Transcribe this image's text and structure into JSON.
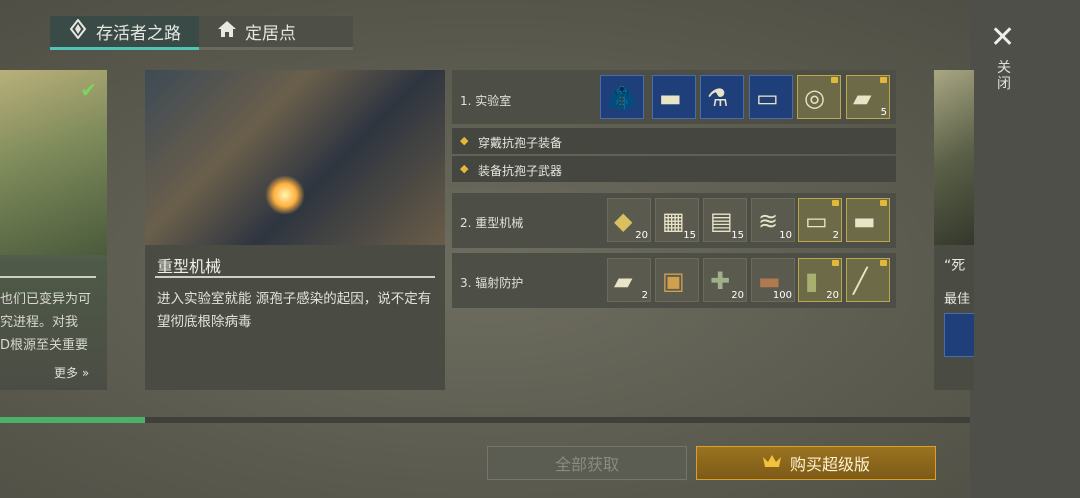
{
  "tabs": [
    {
      "label": "存活者之路",
      "icon": "survivor-emblem-icon"
    },
    {
      "label": "定居点",
      "icon": "home-icon"
    }
  ],
  "left_card": {
    "lines": [
      "也们已变异为可",
      "究进程。对我",
      "D根源至关重要"
    ],
    "more_label": "更多"
  },
  "main_card": {
    "title": "重型机械",
    "description": "进入实验室就能 源孢子感染的起因，说不定有望彻底根除病毒"
  },
  "right_card": {
    "title": "“死",
    "subtitle": "最佳"
  },
  "sections": [
    {
      "label": "1. 实验室",
      "items": [
        {
          "icon": "jacket-icon",
          "count": "",
          "style": "blue",
          "locked": false
        },
        {
          "icon": "pistol-icon",
          "count": "",
          "style": "blue",
          "locked": false
        },
        {
          "icon": "lab-bench-icon",
          "count": "",
          "style": "blue",
          "locked": false
        },
        {
          "icon": "battery-icon",
          "count": "",
          "style": "blue",
          "locked": false
        },
        {
          "icon": "filter-icon",
          "count": "",
          "style": "gold",
          "locked": true
        },
        {
          "icon": "ingot-icon",
          "count": "5",
          "style": "gold",
          "locked": true
        }
      ],
      "sub_items": [
        "穿戴抗孢子装备",
        "装备抗孢子武器"
      ]
    },
    {
      "label": "2. 重型机械",
      "items": [
        {
          "icon": "cloth-icon",
          "count": "20",
          "style": "plain",
          "locked": false
        },
        {
          "icon": "fabric-icon",
          "count": "15",
          "style": "plain",
          "locked": false
        },
        {
          "icon": "scrap-icon",
          "count": "15",
          "style": "plain",
          "locked": false
        },
        {
          "icon": "spring-icon",
          "count": "10",
          "style": "plain",
          "locked": false
        },
        {
          "icon": "battery-icon",
          "count": "2",
          "style": "gold",
          "locked": true
        },
        {
          "icon": "pistol-icon",
          "count": "",
          "style": "gold",
          "locked": true
        }
      ]
    },
    {
      "label": "3. 辐射防护",
      "items": [
        {
          "icon": "ingot-icon",
          "count": "2",
          "style": "plain",
          "locked": false
        },
        {
          "icon": "ammo-box-icon",
          "count": "",
          "style": "plain",
          "locked": false
        },
        {
          "icon": "medkit-icon",
          "count": "20",
          "style": "plain",
          "locked": false
        },
        {
          "icon": "log-icon",
          "count": "100",
          "style": "plain",
          "locked": false
        },
        {
          "icon": "canister-icon",
          "count": "20",
          "style": "gold",
          "locked": true
        },
        {
          "icon": "rifle-icon",
          "count": "",
          "style": "gold",
          "locked": true
        }
      ]
    }
  ],
  "buttons": {
    "claim_all": "全部获取",
    "buy_premium": "购买超级版"
  },
  "close_label": "关闭",
  "progress": 0.15,
  "colors": {
    "accent": "#4fc5b5",
    "gold": "#d7a12b",
    "progress": "#4caf6a"
  }
}
